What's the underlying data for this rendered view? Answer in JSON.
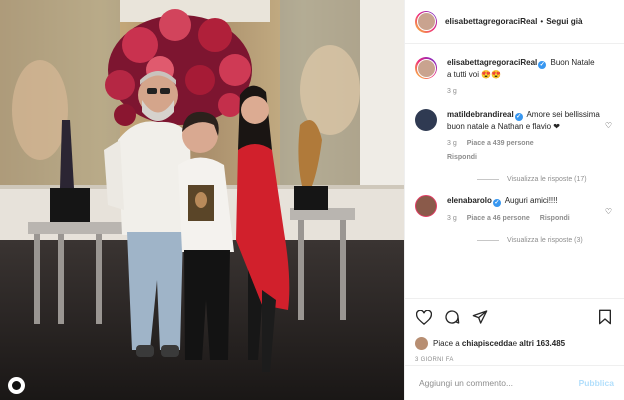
{
  "post": {
    "username": "elisabettagregoraciReal",
    "follow_label": "Segui già",
    "caption_user": "elisabettagregoraciReal",
    "caption_text": "Buon Natale a tutti voi 😍😍",
    "caption_time": "3 g"
  },
  "comments": [
    {
      "user": "matildebrandireal",
      "text": "Amore sei bellissima buon natale a Nathan e flavio ❤",
      "time": "3 g",
      "likes": "Piace a 439 persone",
      "reply_label": "Rispondi",
      "view_replies": "Visualizza le risposte (17)"
    },
    {
      "user": "elenabarolo",
      "text": "Auguri amici!!!!",
      "time": "3 g",
      "likes": "Piace a 46 persone",
      "reply_label": "Rispondi",
      "view_replies": "Visualizza le risposte (3)"
    }
  ],
  "likes_line": {
    "prefix": "Piace a ",
    "first_user": "chiapiscedda",
    "middle": " e ",
    "others": "altri 163.485"
  },
  "post_date": "3 GIORNI FA",
  "comment_box": {
    "placeholder": "Aggiungi un commento...",
    "submit_label": "Pubblica"
  },
  "icons": [
    "heart-icon",
    "comment-icon",
    "share-icon",
    "bookmark-icon"
  ],
  "colors": {
    "verified": "#3897f0",
    "publish_disabled": "#b2dffc",
    "red_dress": "#d1202c"
  }
}
